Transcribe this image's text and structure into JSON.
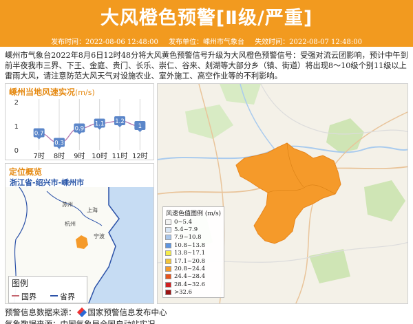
{
  "header": {
    "title": "大风橙色预警[Ⅱ级/严重]",
    "issue_time": "发布时间：2022-08-06 12:48:00",
    "issuer": "发布单位：嵊州市气象台",
    "expire_time": "失效时间：2022-08-07 12:48:00"
  },
  "description": "嵊州市气象台2022年8月6日12时48分将大风黄色预警信号升级为大风橙色预警信号：受强对流云团影响，预计中午到前半夜我市三界、下王、金庭、贵门、长乐、崇仁、谷来、剡湖等大部分乡（镇、街道）将出现8～10级个别11级以上雷雨大风，请注意防范大风天气对设施农业、室外施工、高空作业等的不利影响。",
  "wind_panel": {
    "title": "嵊州当地风速实况",
    "unit": "(m/s)",
    "y_ticks": [
      "0",
      "1",
      "2"
    ],
    "color_line": "#b87ab0",
    "color_box": "#5b86c9"
  },
  "chart_data": {
    "type": "line",
    "title": "嵊州当地风速实况(m/s)",
    "categories": [
      "7时",
      "8时",
      "9时",
      "10时",
      "11时",
      "12时"
    ],
    "values": [
      0.7,
      0.3,
      0.9,
      1.1,
      1.2,
      1
    ],
    "value_labels": [
      "0.7",
      "0.3",
      "0.9",
      "1.1",
      "1.2",
      "1"
    ],
    "ylim": [
      0,
      2
    ],
    "grid": "vertical"
  },
  "location": {
    "title": "定位概览",
    "path": "浙江省-绍兴市-嵊州市",
    "places": [
      "苏州",
      "上海",
      "杭州",
      "宁波"
    ],
    "legend_title": "图例",
    "legend_items": [
      {
        "label": "国界",
        "color": "#c4656f"
      },
      {
        "label": "省界",
        "color": "#2c52a8"
      }
    ]
  },
  "map": {
    "legend_title": "风速色值图例 (m/s)",
    "legend": [
      {
        "label": "0~5.4",
        "color": "#f3f3f3"
      },
      {
        "label": "5.4~7.9",
        "color": "#d9e6f5"
      },
      {
        "label": "7.9~10.8",
        "color": "#a9c6ea"
      },
      {
        "label": "10.8~13.8",
        "color": "#5f95e0"
      },
      {
        "label": "13.8~17.1",
        "color": "#f5ec4b"
      },
      {
        "label": "17.1~20.8",
        "color": "#f2c53a"
      },
      {
        "label": "20.8~24.4",
        "color": "#f59a2a"
      },
      {
        "label": "24.4~28.4",
        "color": "#e8541d"
      },
      {
        "label": "28.4~32.6",
        "color": "#d22020"
      },
      {
        "label": ">32.6",
        "color": "#9b1111"
      }
    ],
    "region_color": "#f59a2a"
  },
  "footer": {
    "source_label": "预警信息数据来源：",
    "source_name": "国家预警信息发布中心",
    "data_source": "气象数据来源：中国气象局全国自动站实况"
  }
}
